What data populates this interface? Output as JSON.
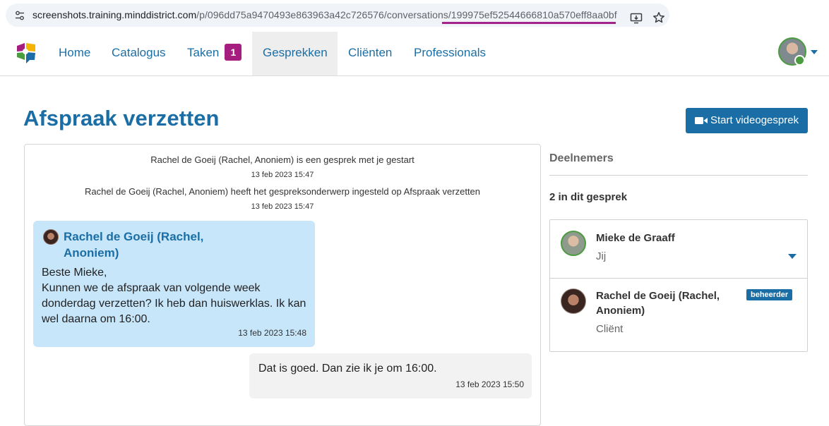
{
  "browser": {
    "url_host_path": "screenshots.training.minddistrict.com",
    "url_rest": "/p/096dd75a9470493e863963a42c726576/conversations/",
    "url_id": "199975ef52544666810a570eff8aa0bf",
    "underline_color": "#a3248a"
  },
  "nav": {
    "items": [
      {
        "label": "Home"
      },
      {
        "label": "Catalogus"
      },
      {
        "label": "Taken",
        "badge": "1"
      },
      {
        "label": "Gesprekken"
      },
      {
        "label": "Cliënten"
      },
      {
        "label": "Professionals"
      }
    ],
    "active": "Gesprekken",
    "accent": "#1b6ea5",
    "badge_color": "#a51d7f"
  },
  "page": {
    "title": "Afspraak verzetten",
    "video_button": "Start videogesprek"
  },
  "conversation": {
    "system": [
      {
        "text": "Rachel de Goeij (Rachel, Anoniem) is een gesprek met je gestart",
        "time": "13 feb 2023 15:47"
      },
      {
        "text": "Rachel de Goeij (Rachel, Anoniem) heeft het gespreksonderwerp ingesteld op Afspraak verzetten",
        "time": "13 feb 2023 15:47"
      }
    ],
    "incoming": {
      "author": "Rachel de Goeij (Rachel, Anoniem)",
      "text": "Beste Mieke,\nKunnen we de afspraak van volgende week donderdag verzetten? Ik heb dan huiswerklas. Ik kan wel daarna om 16:00.",
      "time": "13 feb 2023 15:48",
      "bubble_color": "#c7e6fa"
    },
    "outgoing": {
      "text": "Dat is goed. Dan zie ik je om 16:00.",
      "time": "13 feb 2023 15:50",
      "bubble_color": "#f2f2f2"
    }
  },
  "participants": {
    "heading": "Deelnemers",
    "count": "2 in dit gesprek",
    "list": [
      {
        "name": "Mieke de Graaff",
        "role": "Jij"
      },
      {
        "name": "Rachel de Goeij (Rachel, Anoniem)",
        "role": "Cliënt",
        "badge": "beheerder"
      }
    ]
  }
}
